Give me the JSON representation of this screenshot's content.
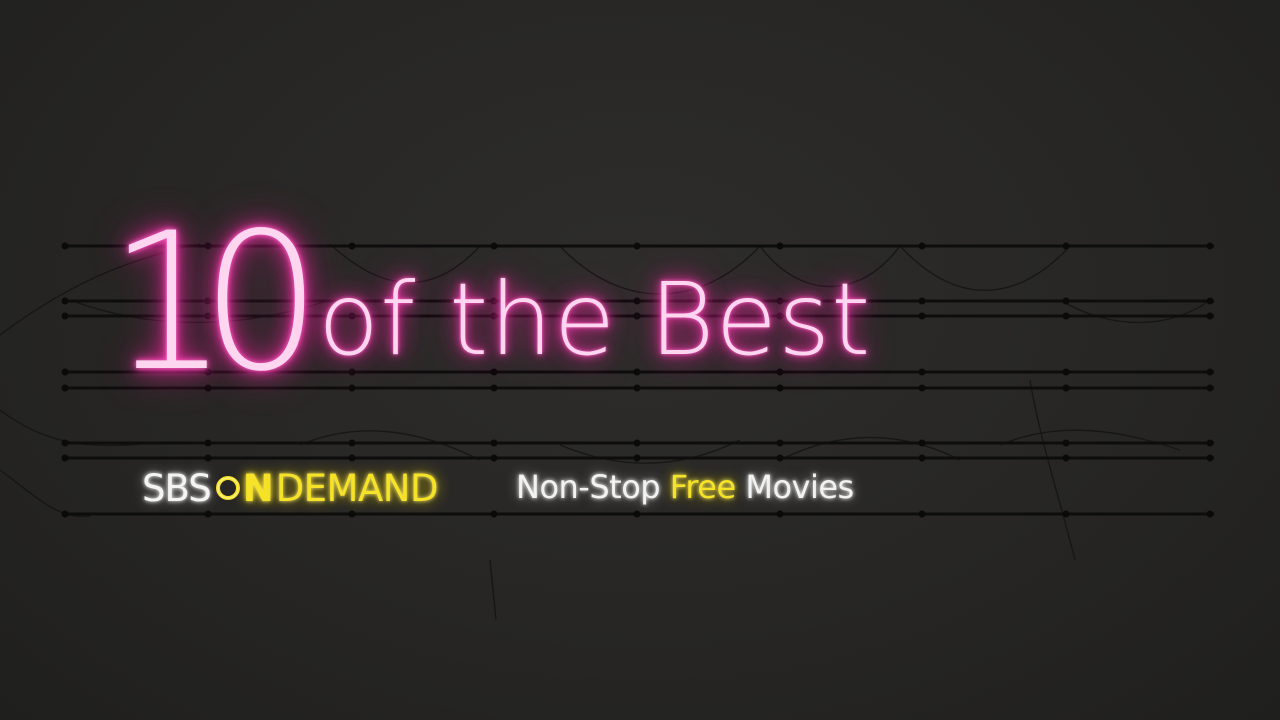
{
  "sign": {
    "number": "10",
    "headline_rest": "of the Best"
  },
  "brand": {
    "sbs": "SBS",
    "on_letter": "N",
    "demand": "DEMAND"
  },
  "tagline": {
    "part1": "Non-Stop",
    "highlight": "Free",
    "part2": "Movies"
  },
  "colors": {
    "background": "#262624",
    "neon_pink": "#ff2aa8",
    "neon_yellow": "#f6e226",
    "neon_white": "#f4f4f2"
  }
}
